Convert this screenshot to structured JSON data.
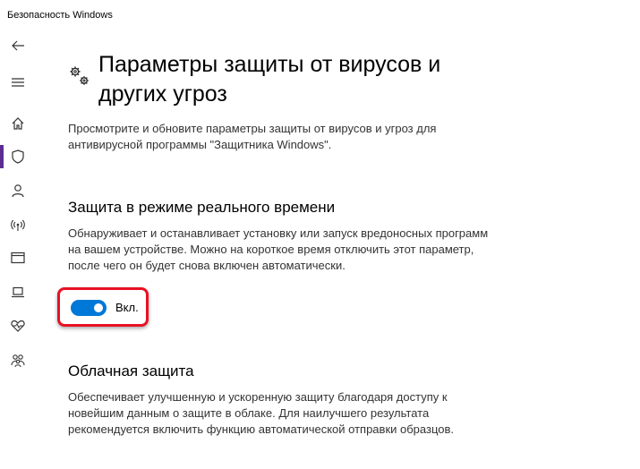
{
  "window": {
    "title": "Безопасность Windows"
  },
  "colors": {
    "accent": "#0078d7",
    "highlight": "#e81123",
    "nav_active": "#5c2d91"
  },
  "sidebar": {
    "items": [
      {
        "name": "back",
        "icon": "back-arrow-icon"
      },
      {
        "name": "menu",
        "icon": "hamburger-icon"
      },
      {
        "name": "home",
        "icon": "home-icon"
      },
      {
        "name": "virus-protection",
        "icon": "shield-icon",
        "active": true
      },
      {
        "name": "account",
        "icon": "person-icon"
      },
      {
        "name": "firewall",
        "icon": "wireless-icon"
      },
      {
        "name": "app-browser",
        "icon": "browser-window-icon"
      },
      {
        "name": "device-security",
        "icon": "laptop-icon"
      },
      {
        "name": "device-health",
        "icon": "heart-pulse-icon"
      },
      {
        "name": "family",
        "icon": "family-icon"
      }
    ]
  },
  "page": {
    "icon": "gears-icon",
    "title": "Параметры защиты от вирусов и других угроз",
    "description": "Просмотрите и обновите параметры защиты от вирусов и угроз для антивирусной программы \"Защитника Windows\"."
  },
  "realtime": {
    "title": "Защита в режиме реального времени",
    "description": "Обнаруживает и останавливает установку или запуск вредоносных программ на вашем устройстве. Можно на короткое время отключить этот параметр, после чего он будет снова включен автоматически.",
    "toggle_on": true,
    "toggle_label": "Вкл."
  },
  "cloud": {
    "title": "Облачная защита",
    "description": "Обеспечивает улучшенную и ускоренную защиту благодаря доступу к новейшим данным о защите в облаке. Для наилучшего результата рекомендуется включить функцию автоматической отправки образцов."
  }
}
